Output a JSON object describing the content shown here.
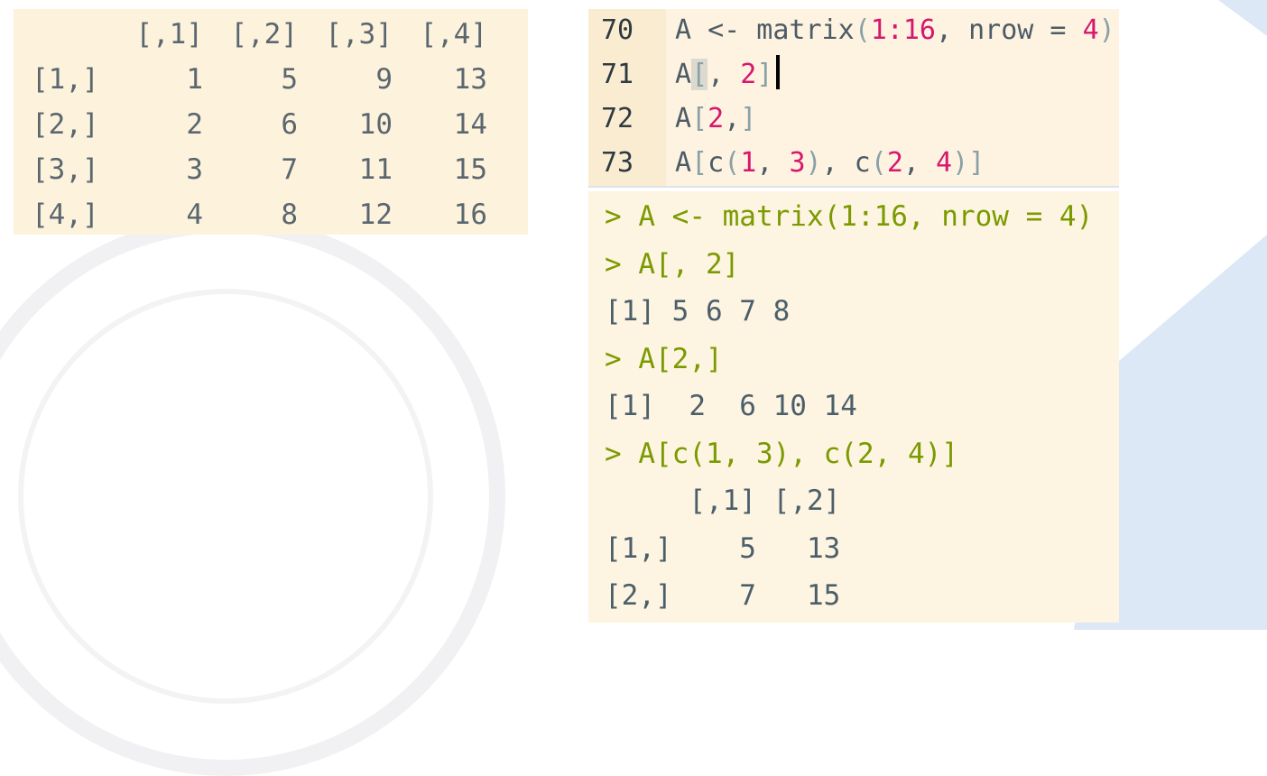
{
  "colors": {
    "panel_bg": "#fdf3dc",
    "number": "#d6176d",
    "command": "#7b9a00",
    "output": "#4b5f6b",
    "accent_shape": "#dce8f5"
  },
  "matrix_output": {
    "header": [
      "[,1]",
      "[,2]",
      "[,3]",
      "[,4]"
    ],
    "rows": [
      {
        "label": "[1,]",
        "values": [
          "1",
          "5",
          "9",
          "13"
        ]
      },
      {
        "label": "[2,]",
        "values": [
          "2",
          "6",
          "10",
          "14"
        ]
      },
      {
        "label": "[3,]",
        "values": [
          "3",
          "7",
          "11",
          "15"
        ]
      },
      {
        "label": "[4,]",
        "values": [
          "4",
          "8",
          "12",
          "16"
        ]
      }
    ]
  },
  "editor": {
    "lines": [
      {
        "num": "70",
        "tokens": [
          {
            "t": "A <- matrix",
            "c": ""
          },
          {
            "t": "(",
            "c": "punc"
          },
          {
            "t": "1:16",
            "c": "num"
          },
          {
            "t": ", nrow = ",
            "c": ""
          },
          {
            "t": "4",
            "c": "num"
          },
          {
            "t": ")",
            "c": "punc"
          }
        ]
      },
      {
        "num": "71",
        "tokens": [
          {
            "t": "A",
            "c": ""
          },
          {
            "t": "[",
            "c": "punc match"
          },
          {
            "t": ", ",
            "c": ""
          },
          {
            "t": "2",
            "c": "num"
          },
          {
            "t": "]",
            "c": "punc"
          }
        ],
        "cursor": true
      },
      {
        "num": "72",
        "tokens": [
          {
            "t": "A",
            "c": ""
          },
          {
            "t": "[",
            "c": "punc"
          },
          {
            "t": "2",
            "c": "num"
          },
          {
            "t": ",",
            "c": ""
          },
          {
            "t": "]",
            "c": "punc"
          }
        ]
      },
      {
        "num": "73",
        "tokens": [
          {
            "t": "A",
            "c": ""
          },
          {
            "t": "[",
            "c": "punc"
          },
          {
            "t": "c",
            "c": ""
          },
          {
            "t": "(",
            "c": "punc"
          },
          {
            "t": "1",
            "c": "num"
          },
          {
            "t": ", ",
            "c": ""
          },
          {
            "t": "3",
            "c": "num"
          },
          {
            "t": ")",
            "c": "punc"
          },
          {
            "t": ", c",
            "c": ""
          },
          {
            "t": "(",
            "c": "punc"
          },
          {
            "t": "2",
            "c": "num"
          },
          {
            "t": ", ",
            "c": ""
          },
          {
            "t": "4",
            "c": "num"
          },
          {
            "t": ")",
            "c": "punc"
          },
          {
            "t": "]",
            "c": "punc"
          }
        ]
      }
    ]
  },
  "console": {
    "lines": [
      {
        "text": "> A <- matrix(1:16, nrow = 4)",
        "type": "cmd"
      },
      {
        "text": "> A[, 2]",
        "type": "cmd"
      },
      {
        "text": "[1] 5 6 7 8",
        "type": "out"
      },
      {
        "text": "> A[2,]",
        "type": "cmd"
      },
      {
        "text": "[1]  2  6 10 14",
        "type": "out"
      },
      {
        "text": "> A[c(1, 3), c(2, 4)]",
        "type": "cmd"
      },
      {
        "text": "     [,1] [,2]",
        "type": "out"
      },
      {
        "text": "[1,]    5   13",
        "type": "out"
      },
      {
        "text": "[2,]    7   15",
        "type": "out"
      }
    ]
  }
}
